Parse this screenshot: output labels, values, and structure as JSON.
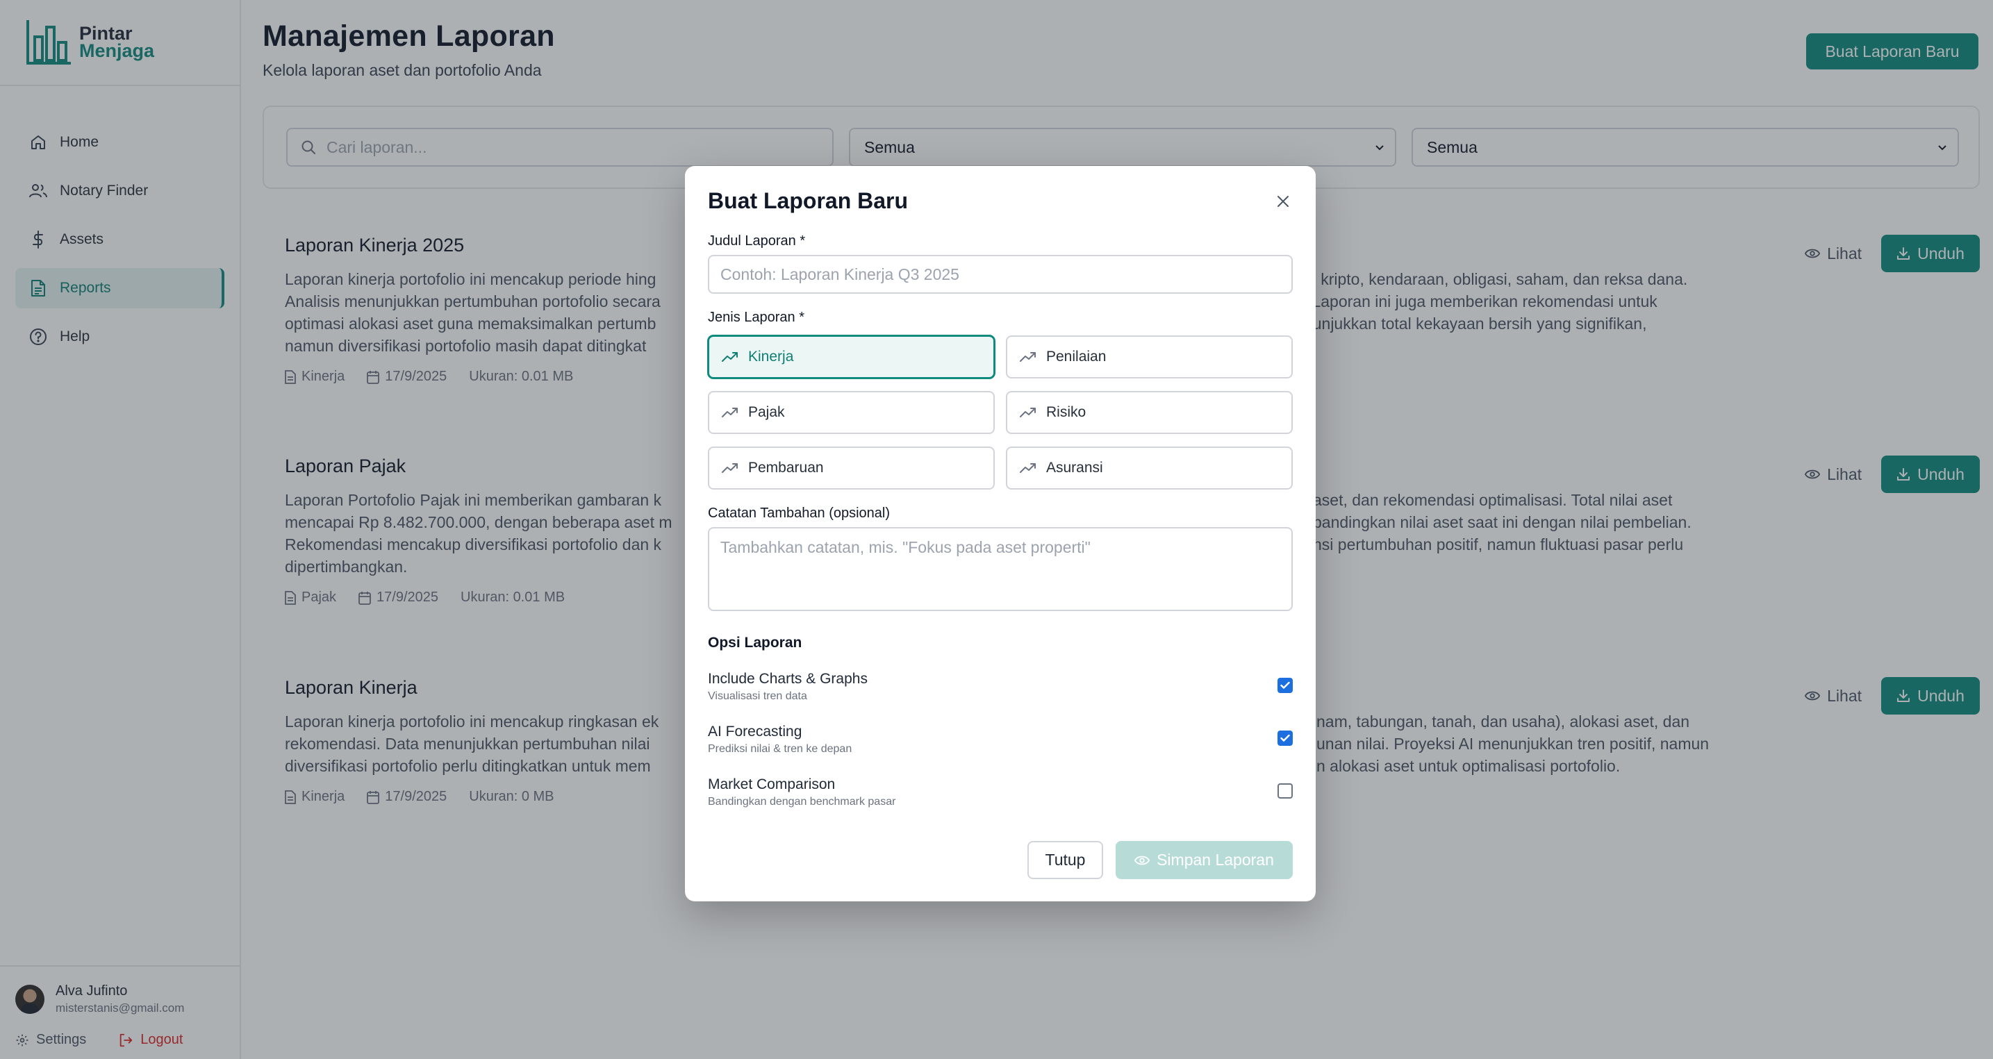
{
  "brand": {
    "line1": "Pintar",
    "line2": "Menjaga"
  },
  "nav": [
    {
      "label": "Home",
      "icon": "home-icon",
      "active": false
    },
    {
      "label": "Notary Finder",
      "icon": "users-icon",
      "active": false
    },
    {
      "label": "Assets",
      "icon": "dollar-icon",
      "active": false
    },
    {
      "label": "Reports",
      "icon": "file-icon",
      "active": true
    },
    {
      "label": "Help",
      "icon": "help-icon",
      "active": false
    }
  ],
  "user": {
    "name": "Alva Jufinto",
    "email": "misterstanis@gmail.com"
  },
  "sidebar_actions": {
    "settings": "Settings",
    "logout": "Logout"
  },
  "header": {
    "title": "Manajemen Laporan",
    "subtitle": "Kelola laporan aset dan portofolio Anda",
    "new_button": "Buat Laporan Baru"
  },
  "filters": {
    "search_placeholder": "Cari laporan...",
    "select1": "Semua",
    "select2": "Semua"
  },
  "reports": [
    {
      "title": "Laporan Kinerja 2025",
      "desc_left": "Laporan kinerja portofolio ini mencakup periode hing\nAnalisis menunjukkan pertumbuhan portofolio secara\noptimasi alokasi aset guna memaksimalkan pertumb\nnamun diversifikasi portofolio masih dapat ditingkat",
      "desc_right": "mas, kripto, kendaraan, obligasi, saham, dan reksa dana.\nsar. Laporan ini juga memberikan rekomendasi untuk\nmenunjukkan total kekayaan bersih yang signifikan,",
      "type": "Kinerja",
      "date": "17/9/2025",
      "size": "Ukuran: 0.01 MB"
    },
    {
      "title": "Laporan Pajak",
      "desc_left": "Laporan Portofolio Pajak ini memberikan gambaran k\nmencapai Rp 8.482.700.000, dengan beberapa aset m\nRekomendasi mencakup diversifikasi portofolio dan k\ndipertimbangkan.",
      "desc_right": "aset, dan rekomendasi optimalisasi. Total nilai aset\nbandingkan nilai aset saat ini dengan nilai pembelian.\nnsi pertumbuhan positif, namun fluktuasi pasar perlu",
      "type": "Pajak",
      "date": "17/9/2025",
      "size": "Ukuran: 0.01 MB"
    },
    {
      "title": "Laporan Kinerja",
      "desc_left": "Laporan kinerja portofolio ini mencakup ringkasan ek\nrekomendasi. Data menunjukkan pertumbuhan nilai\ndiversifikasi portofolio perlu ditingkatkan untuk mem",
      "desc_right": "nam, tabungan, tanah, dan usaha), alokasi aset, dan\nunan nilai. Proyeksi AI menunjukkan tren positif, namun\nn alokasi aset untuk optimalisasi portofolio.",
      "type": "Kinerja",
      "date": "17/9/2025",
      "size": "Ukuran: 0 MB"
    }
  ],
  "report_actions": {
    "view": "Lihat",
    "download": "Unduh"
  },
  "modal": {
    "title": "Buat Laporan Baru",
    "title_label": "Judul Laporan *",
    "title_placeholder": "Contoh: Laporan Kinerja Q3 2025",
    "type_label": "Jenis Laporan *",
    "types": [
      {
        "label": "Kinerja",
        "selected": true
      },
      {
        "label": "Penilaian",
        "selected": false
      },
      {
        "label": "Pajak",
        "selected": false
      },
      {
        "label": "Risiko",
        "selected": false
      },
      {
        "label": "Pembaruan",
        "selected": false
      },
      {
        "label": "Asuransi",
        "selected": false
      }
    ],
    "notes_label": "Catatan Tambahan (opsional)",
    "notes_placeholder": "Tambahkan catatan, mis. \"Fokus pada aset properti\"",
    "options_heading": "Opsi Laporan",
    "options": [
      {
        "title": "Include Charts & Graphs",
        "desc": "Visualisasi tren data",
        "checked": true
      },
      {
        "title": "AI Forecasting",
        "desc": "Prediksi nilai & tren ke depan",
        "checked": true
      },
      {
        "title": "Market Comparison",
        "desc": "Bandingkan dengan benchmark pasar",
        "checked": false
      }
    ],
    "close_button": "Tutup",
    "save_button": "Simpan Laporan"
  },
  "colors": {
    "accent": "#0f8a7e",
    "checkbox": "#1d6fe0",
    "logout": "#dc2626"
  }
}
